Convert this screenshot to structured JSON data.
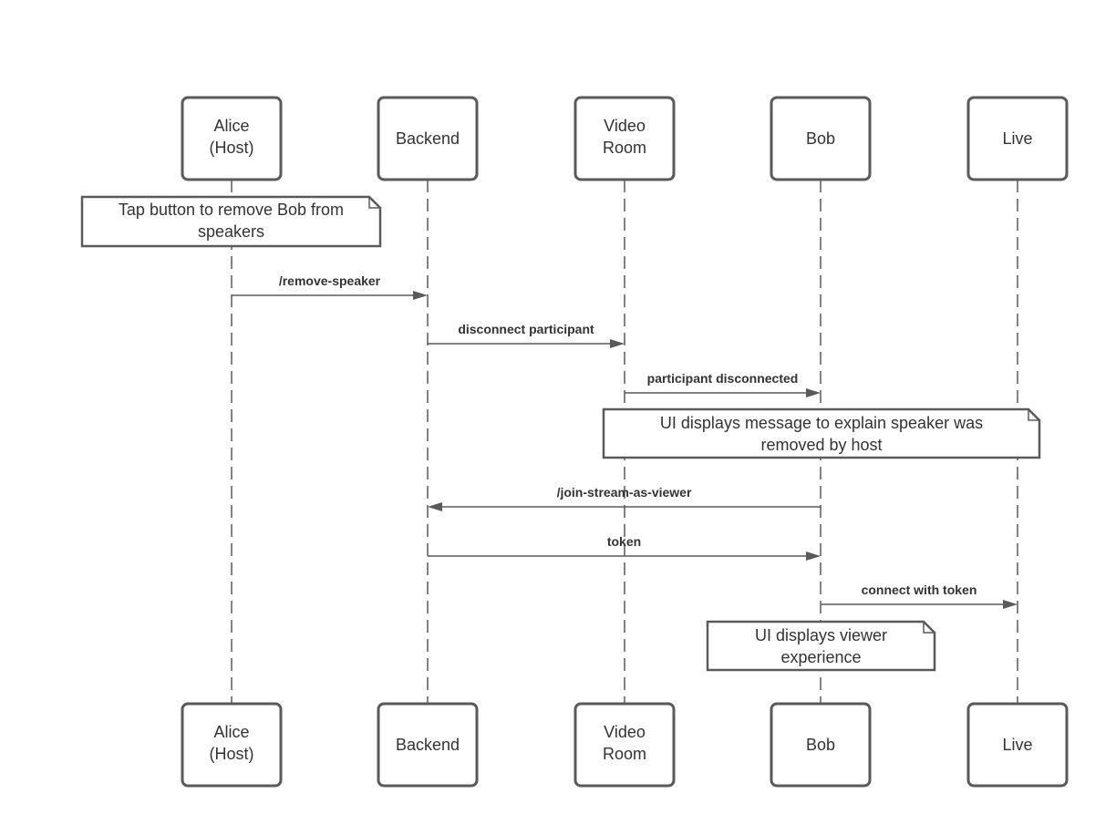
{
  "participants": [
    {
      "id": "alice",
      "lines": [
        "Alice",
        "(Host)"
      ]
    },
    {
      "id": "backend",
      "lines": [
        "Backend"
      ]
    },
    {
      "id": "video-room",
      "lines": [
        "Video",
        "Room"
      ]
    },
    {
      "id": "bob",
      "lines": [
        "Bob"
      ]
    },
    {
      "id": "live",
      "lines": [
        "Live"
      ]
    }
  ],
  "messages": [
    {
      "from": 0,
      "to": 1,
      "label": "/remove-speaker"
    },
    {
      "from": 1,
      "to": 2,
      "label": "disconnect participant"
    },
    {
      "from": 2,
      "to": 3,
      "label": "participant disconnected"
    },
    {
      "from": 3,
      "to": 1,
      "label": "/join-stream-as-viewer"
    },
    {
      "from": 1,
      "to": 3,
      "label": "token"
    },
    {
      "from": 3,
      "to": 4,
      "label": "connect with token"
    }
  ],
  "notes": [
    {
      "lines": [
        "Tap button to remove Bob from",
        "speakers"
      ]
    },
    {
      "lines": [
        "UI displays message to explain speaker was",
        "removed by host"
      ]
    },
    {
      "lines": [
        "UI displays viewer",
        "experience"
      ]
    }
  ],
  "colors": {
    "stroke": "#5a5a5a",
    "text": "#333333"
  }
}
